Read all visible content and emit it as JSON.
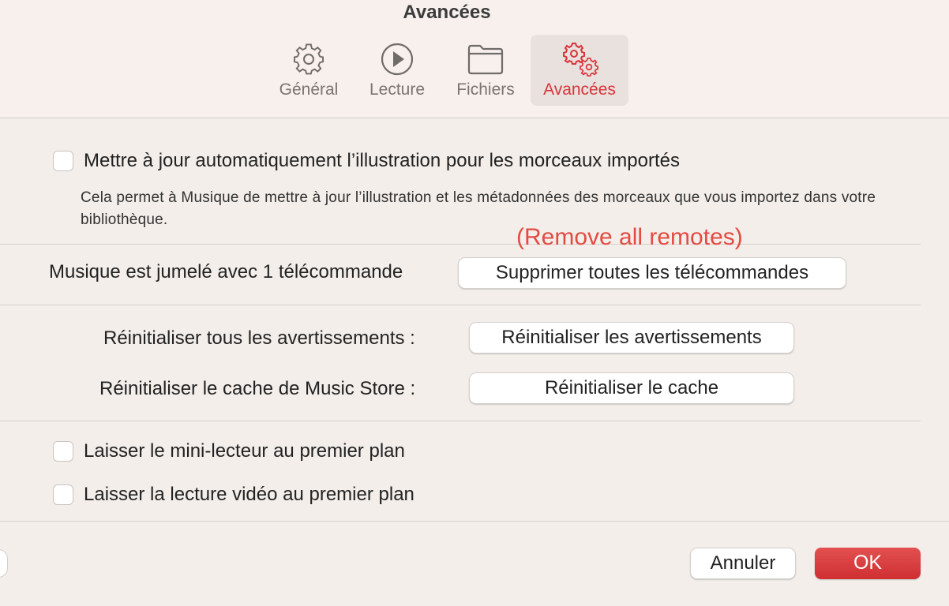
{
  "window": {
    "title": "Avancées"
  },
  "tabs": [
    {
      "label": "Général",
      "icon": "gear-icon"
    },
    {
      "label": "Lecture",
      "icon": "play-circle-icon"
    },
    {
      "label": "Fichiers",
      "icon": "folder-icon"
    },
    {
      "label": "Avancées",
      "icon": "gears-icon",
      "active": true
    }
  ],
  "artwork": {
    "checkbox_label": "Mettre à jour automatiquement l’illustration pour les morceaux importés",
    "checked": false,
    "description": "Cela permet à Musique de mettre à jour l’illustration et les métadonnées des morceaux que vous importez dans votre bibliothèque."
  },
  "remotes": {
    "status": "Musique est jumelé avec 1 télécommande",
    "button_label": "Supprimer toutes les télécommandes",
    "annotation": "(Remove all remotes)"
  },
  "reset": {
    "warnings_label": "Réinitialiser tous les avertissements :",
    "warnings_button": "Réinitialiser les avertissements",
    "cache_label": "Réinitialiser le cache de Music Store :",
    "cache_button": "Réinitialiser le cache"
  },
  "float": {
    "mini_player_label": "Laisser le mini-lecteur au premier plan",
    "mini_player_checked": false,
    "video_label": "Laisser la lecture vidéo au premier plan",
    "video_checked": false
  },
  "footer": {
    "cancel_label": "Annuler",
    "ok_label": "OK"
  },
  "colors": {
    "accent": "#d9343b",
    "annotation": "#e34b43",
    "background": "#f3eeea"
  }
}
